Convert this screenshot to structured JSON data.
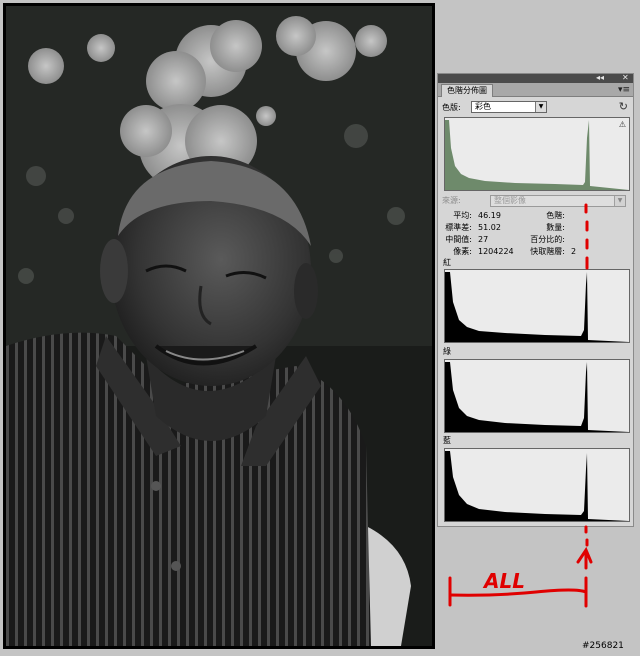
{
  "photo": {
    "description_icon": "portrait-photo"
  },
  "panel": {
    "collapse_glyph": "◂◂",
    "close_glyph": "✕",
    "title": "色階分佈圖",
    "tab_close": "×",
    "menu_icon": "panel-menu-icon",
    "menu_glyph": "▾≡",
    "channel_label": "色版:",
    "channel_value": "彩色",
    "refresh_glyph": "↻",
    "warn_glyph": "⚠",
    "source_label": "來源:",
    "source_value": "整個影像",
    "stats": {
      "mean_label": "平均:",
      "mean_value": "46.19",
      "std_label": "標準差:",
      "std_value": "51.02",
      "median_label": "中間值:",
      "median_value": "27",
      "pixels_label": "像素:",
      "pixels_value": "1204224",
      "level_label": "色階:",
      "count_label": "數量:",
      "percentile_label": "百分比的:",
      "cache_label": "快取階層:",
      "cache_value": "2"
    },
    "channels": {
      "red_label": "紅",
      "green_label": "綠",
      "blue_label": "藍"
    },
    "colors": {
      "composite_fill": "#6e8a6b",
      "channel_fill": "#000000"
    }
  },
  "annotation": {
    "text": "ALL",
    "color": "#e00000"
  },
  "watermark": "#256821"
}
